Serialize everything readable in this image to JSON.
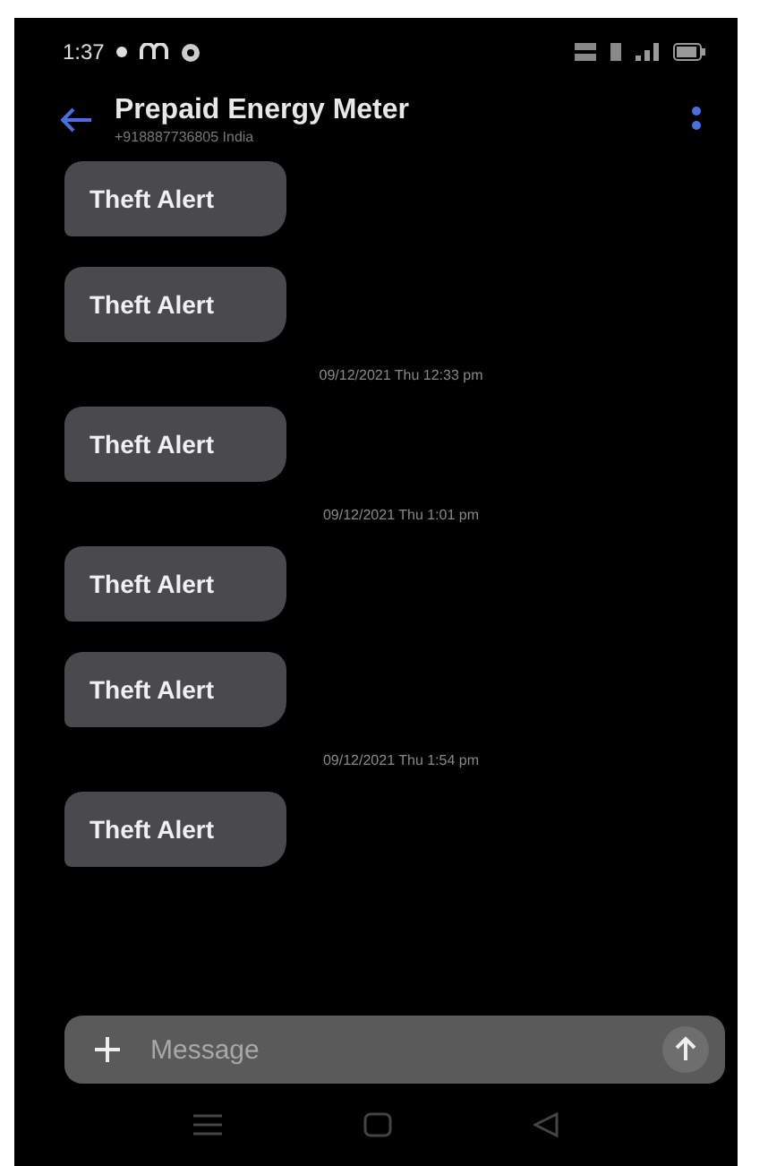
{
  "status_bar": {
    "time": "1:37"
  },
  "header": {
    "title": "Prepaid Energy Meter",
    "subtitle": "+918887736805 India"
  },
  "messages": [
    {
      "kind": "message",
      "text": "Theft Alert"
    },
    {
      "kind": "message",
      "text": "Theft Alert"
    },
    {
      "kind": "timestamp",
      "text": "09/12/2021 Thu 12:33 pm"
    },
    {
      "kind": "message",
      "text": "Theft Alert"
    },
    {
      "kind": "timestamp",
      "text": "09/12/2021 Thu 1:01 pm"
    },
    {
      "kind": "message",
      "text": "Theft Alert"
    },
    {
      "kind": "message",
      "text": "Theft Alert"
    },
    {
      "kind": "timestamp",
      "text": "09/12/2021 Thu 1:54 pm"
    },
    {
      "kind": "message",
      "text": "Theft Alert"
    }
  ],
  "composer": {
    "placeholder": "Message"
  }
}
